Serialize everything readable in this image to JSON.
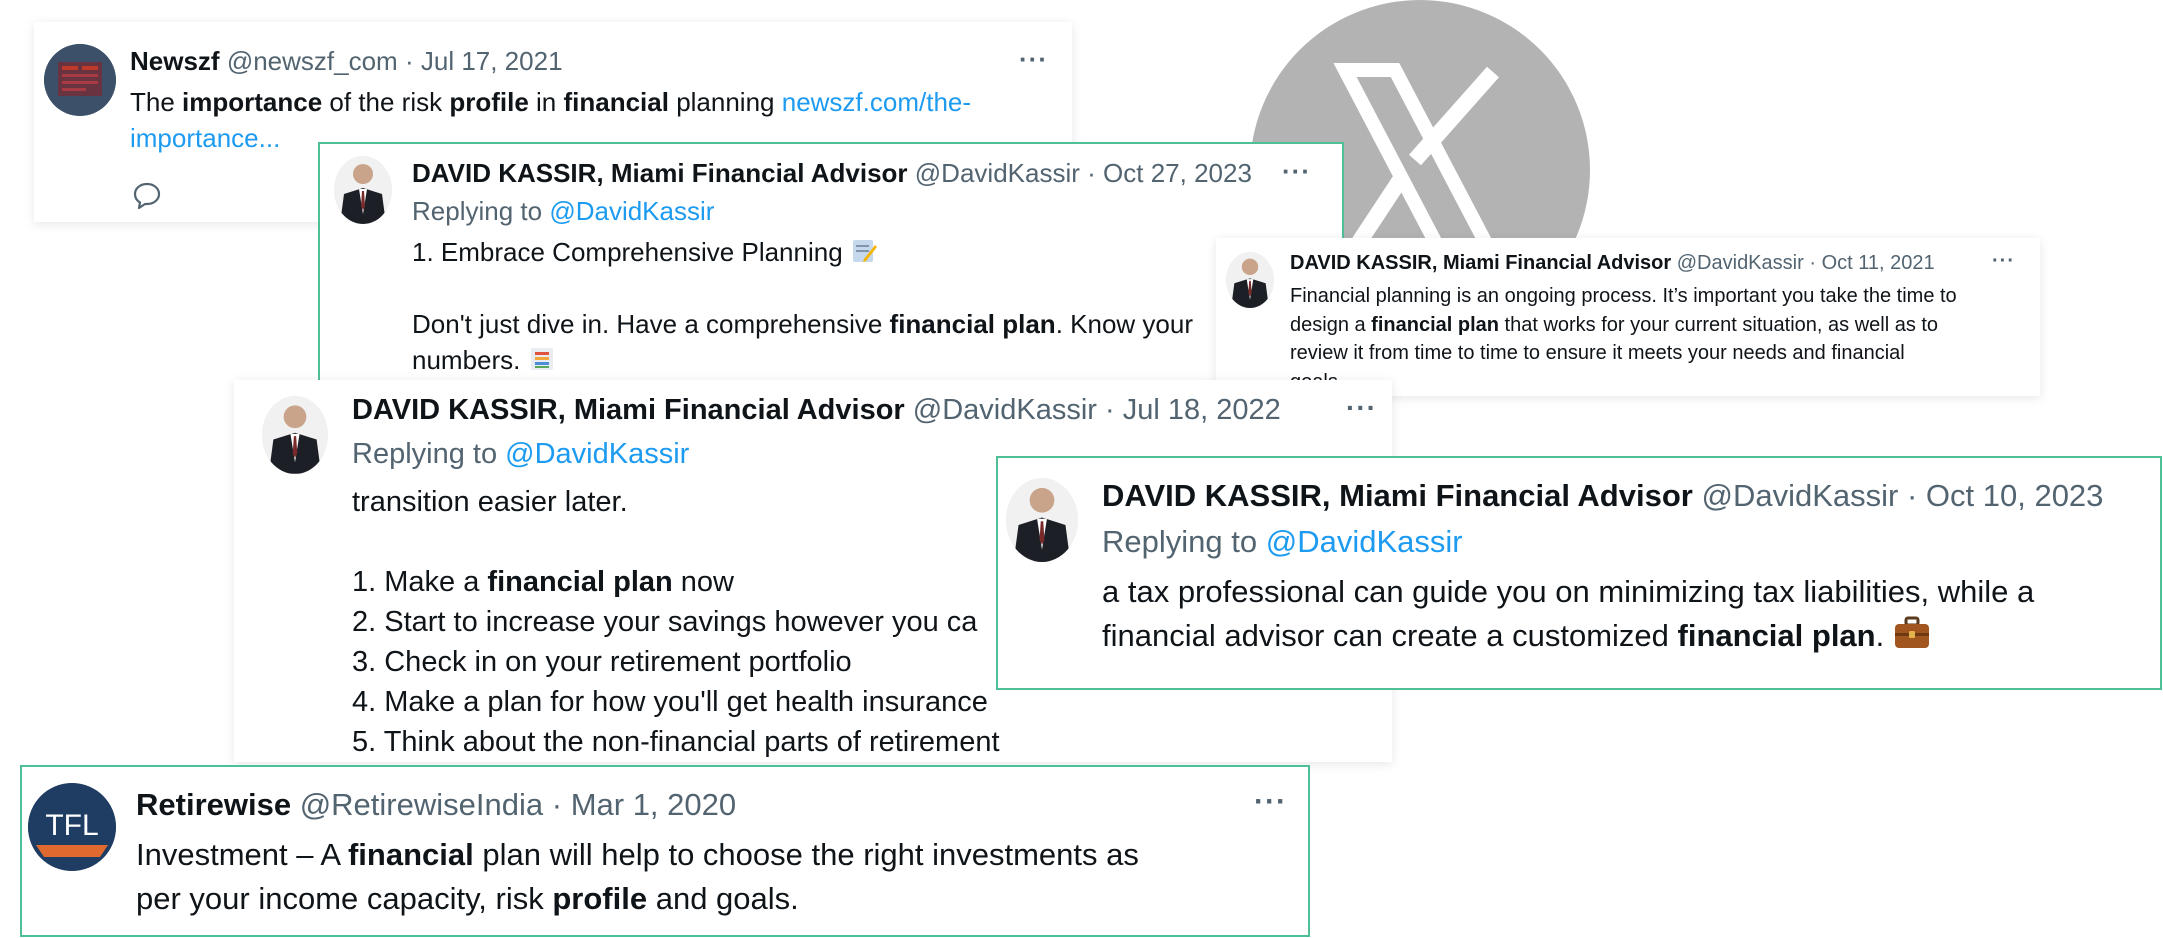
{
  "tweets": {
    "newszf": {
      "name": "Newszf",
      "handle": "@newszf_com",
      "date": "Jul 17, 2021",
      "text_parts": [
        "The ",
        "importance",
        " of the risk ",
        "profile",
        " in ",
        "financial",
        " planning "
      ],
      "link_line1": "newszf.com/the-",
      "link_line2": "importance...",
      "more": "···"
    },
    "kassir_oct27": {
      "name": "DAVID KASSIR, Miami Financial Advisor",
      "handle": "@DavidKassir",
      "date": "Oct 27, 2023",
      "replying_label": "Replying to",
      "replying_handle": "@DavidKassir",
      "line1": "1. Embrace Comprehensive Planning",
      "line2_a": "Don't just dive in. Have a comprehensive ",
      "line2_b": "financial plan",
      "line2_c": ". Know your",
      "line3": "numbers.",
      "more": "···"
    },
    "kassir_oct11": {
      "name": "DAVID KASSIR, Miami Financial Advisor",
      "handle": "@DavidKassir",
      "date": "Oct 11, 2021",
      "line1": "Financial planning is an ongoing process. It’s important you take the time to",
      "line2_a": "design a ",
      "line2_b": "financial plan",
      "line2_c": " that works for your current situation, as well as to",
      "line3": "review it from time to time to ensure it meets your needs and financial",
      "line4": "goals.",
      "more": "···"
    },
    "kassir_jul18": {
      "name": "DAVID KASSIR, Miami Financial Advisor",
      "handle": "@DavidKassir",
      "date": "Jul 18, 2022",
      "replying_label": "Replying to",
      "replying_handle": "@DavidKassir",
      "line0": "transition easier later.",
      "item1_a": "1. Make a ",
      "item1_b": "financial plan",
      "item1_c": " now",
      "item2": "2. Start to increase your savings however you ca",
      "item3": "3. Check in on your retirement portfolio",
      "item4": "4. Make a plan for how you'll get health insurance",
      "item5": "5. Think about the non-financial parts of retirement",
      "more": "···"
    },
    "kassir_oct10": {
      "name": "DAVID KASSIR, Miami Financial Advisor",
      "handle": "@DavidKassir",
      "date": "Oct 10, 2023",
      "replying_label": "Replying to",
      "replying_handle": "@DavidKassir",
      "line1": "a tax professional can guide you on minimizing tax liabilities, while a",
      "line2_a": "financial advisor can create a customized ",
      "line2_b": "financial plan",
      "line2_c": "."
    },
    "retirewise": {
      "name": "Retirewise",
      "handle": "@RetirewiseIndia",
      "date": "Mar 1, 2020",
      "avatar_text": "TFL",
      "line1_a": "Investment – A ",
      "line1_b": "financial",
      "line1_c": " plan will help to choose the right investments as",
      "line2_a": "per your income capacity, risk ",
      "line2_b": "profile",
      "line2_c": " and goals.",
      "more": "···"
    }
  },
  "separator": "·",
  "icons": {
    "reply": "reply-bubble-icon",
    "more": "more-dots-icon",
    "x_logo": "x-logo-icon",
    "memo": "memo-emoji-icon",
    "chart": "bar-chart-emoji-icon",
    "briefcase": "briefcase-emoji-icon"
  },
  "colors": {
    "link": "#1d9bf0",
    "meta": "#536471",
    "border": "#4fbf96",
    "x_logo_bg": "#b3b3b3"
  }
}
